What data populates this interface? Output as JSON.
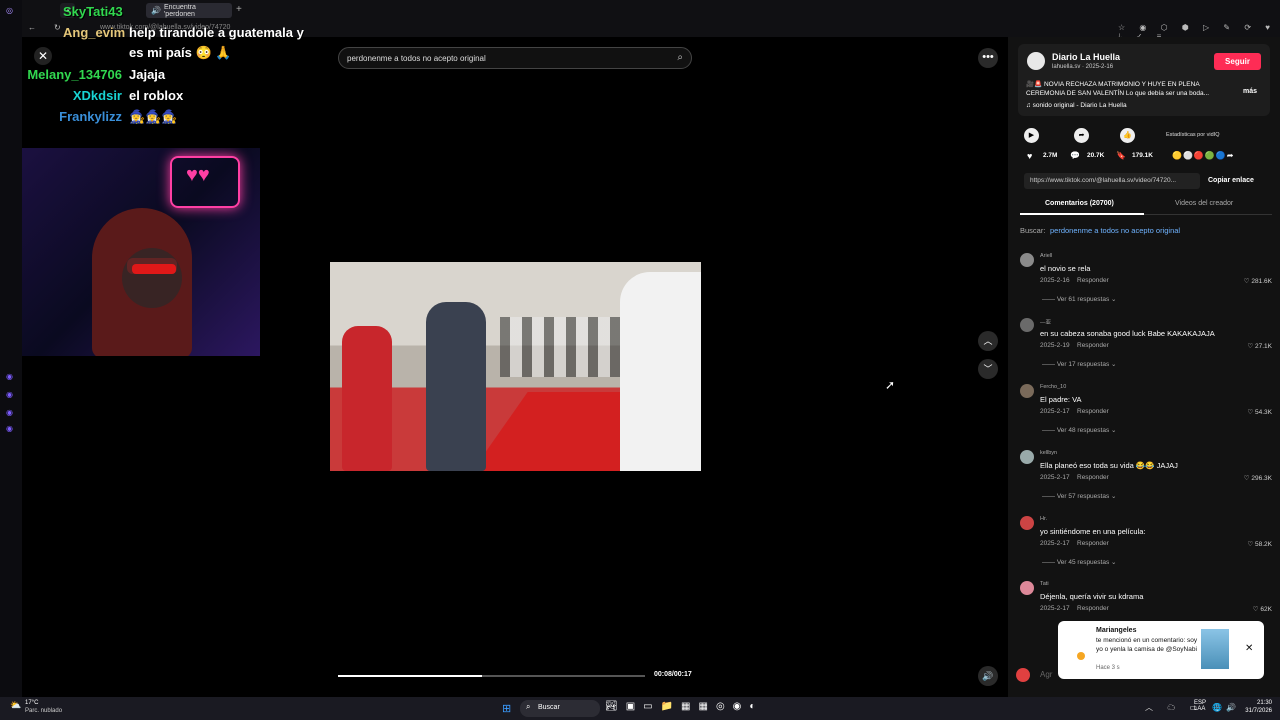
{
  "chat": {
    "messages": [
      {
        "user": "SkyTati43",
        "text": "",
        "color": "#31d84f"
      },
      {
        "user": "Ang_evim",
        "text": "help tirandole a guatemala y",
        "color": "#e5c77a"
      },
      {
        "user": "",
        "text": "es mi país 😳 🙏",
        "color": "#ffffff"
      },
      {
        "user": "Melany_134706",
        "text": "Jajaja",
        "color": "#31d84f"
      },
      {
        "user": "XDkdsir",
        "text": "el roblox",
        "color": "#19d3d3"
      },
      {
        "user": "Frankylizz",
        "text": "🧙‍♀️🧙‍♀️🧙‍♀️",
        "color": "#3a8fd9"
      }
    ]
  },
  "browser": {
    "tab_label": "Encuentra 'perdonen",
    "url": "www.tiktok.com/@lahuella.sv/video/74720"
  },
  "search": {
    "query": "perdonenme a todos no acepto original"
  },
  "player": {
    "time": "00:08/00:17",
    "progress": 0.47
  },
  "post": {
    "author": "Diario La Huella",
    "handle": "lahuella.sv · 2025-2-16",
    "follow_label": "Seguir",
    "caption": "🎥🚨 NOVIA RECHAZA MATRIMONIO Y HUYE EN PLENA CEREMONIA DE SAN VALENTÍN Lo que debía ser una boda...",
    "more_label": "más",
    "sound": "♫ sonido original - Diario La Huella",
    "stats_label": "Estadísticas por vidIQ",
    "likes": "2.7M",
    "comments": "20.7K",
    "saves": "179.1K",
    "link": "https://www.tiktok.com/@lahuella.sv/video/74720...",
    "copy_label": "Copiar enlace",
    "tab_comments": "Comentarios (20700)",
    "tab_creator": "Videos del creador",
    "search_label": "Buscar:",
    "search_link": "perdonenme a todos no acepto original"
  },
  "comments": [
    {
      "user": "Ariell",
      "text": "el novio se rela",
      "date": "2025-2-16",
      "reply": "Responder",
      "likes": "281.6K",
      "replies": "Ver 61 respuestas"
    },
    {
      "user": "—亚",
      "text": "en su cabeza sonaba good luck Babe KAKAKAJAJA",
      "date": "2025-2-19",
      "reply": "Responder",
      "likes": "27.1K",
      "replies": "Ver 17 respuestas"
    },
    {
      "user": "Fercho_10",
      "text": "El padre: VA",
      "date": "2025-2-17",
      "reply": "Responder",
      "likes": "54.3K",
      "replies": "Ver 48 respuestas"
    },
    {
      "user": "kellbyn",
      "text": "Ella planeó eso toda su vida 😂😂 JAJAJ",
      "date": "2025-2-17",
      "reply": "Responder",
      "likes": "296.3K",
      "replies": "Ver 57 respuestas"
    },
    {
      "user": "Hr.",
      "text": "yo sintiéndome en una película:",
      "date": "2025-2-17",
      "reply": "Responder",
      "likes": "58.2K",
      "replies": "Ver 45 respuestas"
    },
    {
      "user": "Tati",
      "text": "Déjenla, quería vivir su kdrama",
      "date": "2025-2-17",
      "reply": "Responder",
      "likes": "62K",
      "replies": ""
    }
  ],
  "notification": {
    "user": "Mariangeles",
    "text": "te mencionó en un comentario: soy yo o yenla la camisa de @SoyNabi",
    "time": "Hace 3 s"
  },
  "taskbar": {
    "weather": "17°C",
    "weather_desc": "Parc. nublado",
    "search": "Buscar",
    "lang": "ESP LAA",
    "time": "21:30",
    "date": "31/7/2026"
  }
}
